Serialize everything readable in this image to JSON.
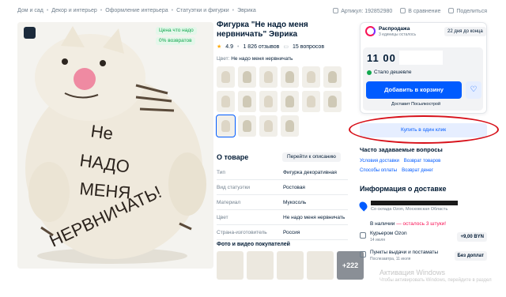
{
  "breadcrumb": [
    "Дом и сад",
    "Декор и интерьер",
    "Оформление интерьера",
    "Статуэтки и фигурки",
    "Эврика"
  ],
  "top_actions": {
    "article": "Артикул: 192852980",
    "compare": "В сравнение",
    "share": "Поделиться"
  },
  "gallery": {
    "tag_original": "Цена что надо",
    "tag_returns": "0% возвратов",
    "figure_text_lines": [
      "Не",
      "НАДО",
      "МЕНЯ",
      "НЕРВНИЧАТЬ!"
    ]
  },
  "product": {
    "title": "Фигурка \"Не надо меня нервничать\" Эврика",
    "rating": "4.9",
    "reviews": "1 826 отзывов",
    "questions": "15 вопросов",
    "color_label": "Цвет:",
    "color_value": "Не надо меня нервничать"
  },
  "about": {
    "heading": "О товаре",
    "go_to_description": "Перейти к описанию",
    "specs": [
      {
        "k": "Тип",
        "v": "Фигурка декоративная"
      },
      {
        "k": "Вид статуэтки",
        "v": "Ростовая"
      },
      {
        "k": "Материал",
        "v": "Мукосоль"
      },
      {
        "k": "Цвет",
        "v": "Не надо меня нервничать"
      },
      {
        "k": "Страна-изготовитель",
        "v": "Россия"
      }
    ]
  },
  "media": {
    "heading": "Фото и видео покупателей",
    "more": "+222"
  },
  "buy_card": {
    "sale_title": "Распродажа",
    "sale_sub": "3 единицы осталось",
    "sale_pill": "22 дня до конца",
    "price": "11 00 BYN",
    "cheaper": "Стало дешевле",
    "add_to_cart": "Добавить в корзину",
    "delivery_by": "Доставит Посылкострой"
  },
  "one_click": "Купить в один клик",
  "faq": {
    "heading": "Часто задаваемые вопросы",
    "links": [
      "Условия доставки",
      "Возврат товаров",
      "Способы оплаты",
      "Возврат денег"
    ]
  },
  "delivery": {
    "heading": "Информация о доставке",
    "address_sub": "Со склада Ozon, Московская Область",
    "stock": "В наличии",
    "stock_left": "— осталось 3 штуки!",
    "options": [
      {
        "t": "Курьером Ozon",
        "s": "14 июля",
        "p": "+9,00 BYN"
      },
      {
        "t": "Пункты выдачи и постаматы",
        "s": "Послезавтра, 11 июля",
        "p": "Без доплат"
      }
    ]
  },
  "watermark": {
    "line1": "Активация Windows",
    "line2": "Чтобы активировать Windows, перейдите в раздел"
  },
  "colors": {
    "accent": "#005bff",
    "sale": "#f91155",
    "green": "#11a84e",
    "annotation": "#d7111a"
  }
}
